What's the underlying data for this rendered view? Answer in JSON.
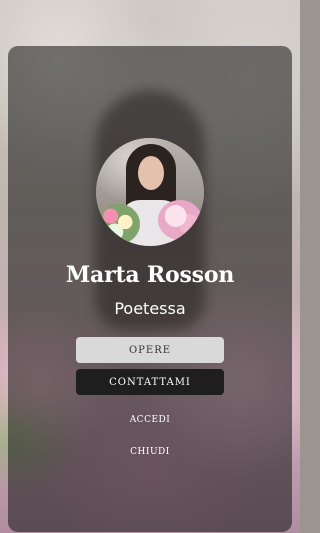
{
  "profile": {
    "name": "Marta Rosson",
    "role": "Poetessa"
  },
  "actions": {
    "works_label": "OPERE",
    "contact_label": "CONTATTAMI",
    "login_label": "ACCEDI",
    "close_label": "CHIUDI"
  },
  "colors": {
    "card_overlay": "#141414",
    "primary_button": "#d9d9d9",
    "secondary_button": "#1e1e1e",
    "text": "#ffffff"
  }
}
